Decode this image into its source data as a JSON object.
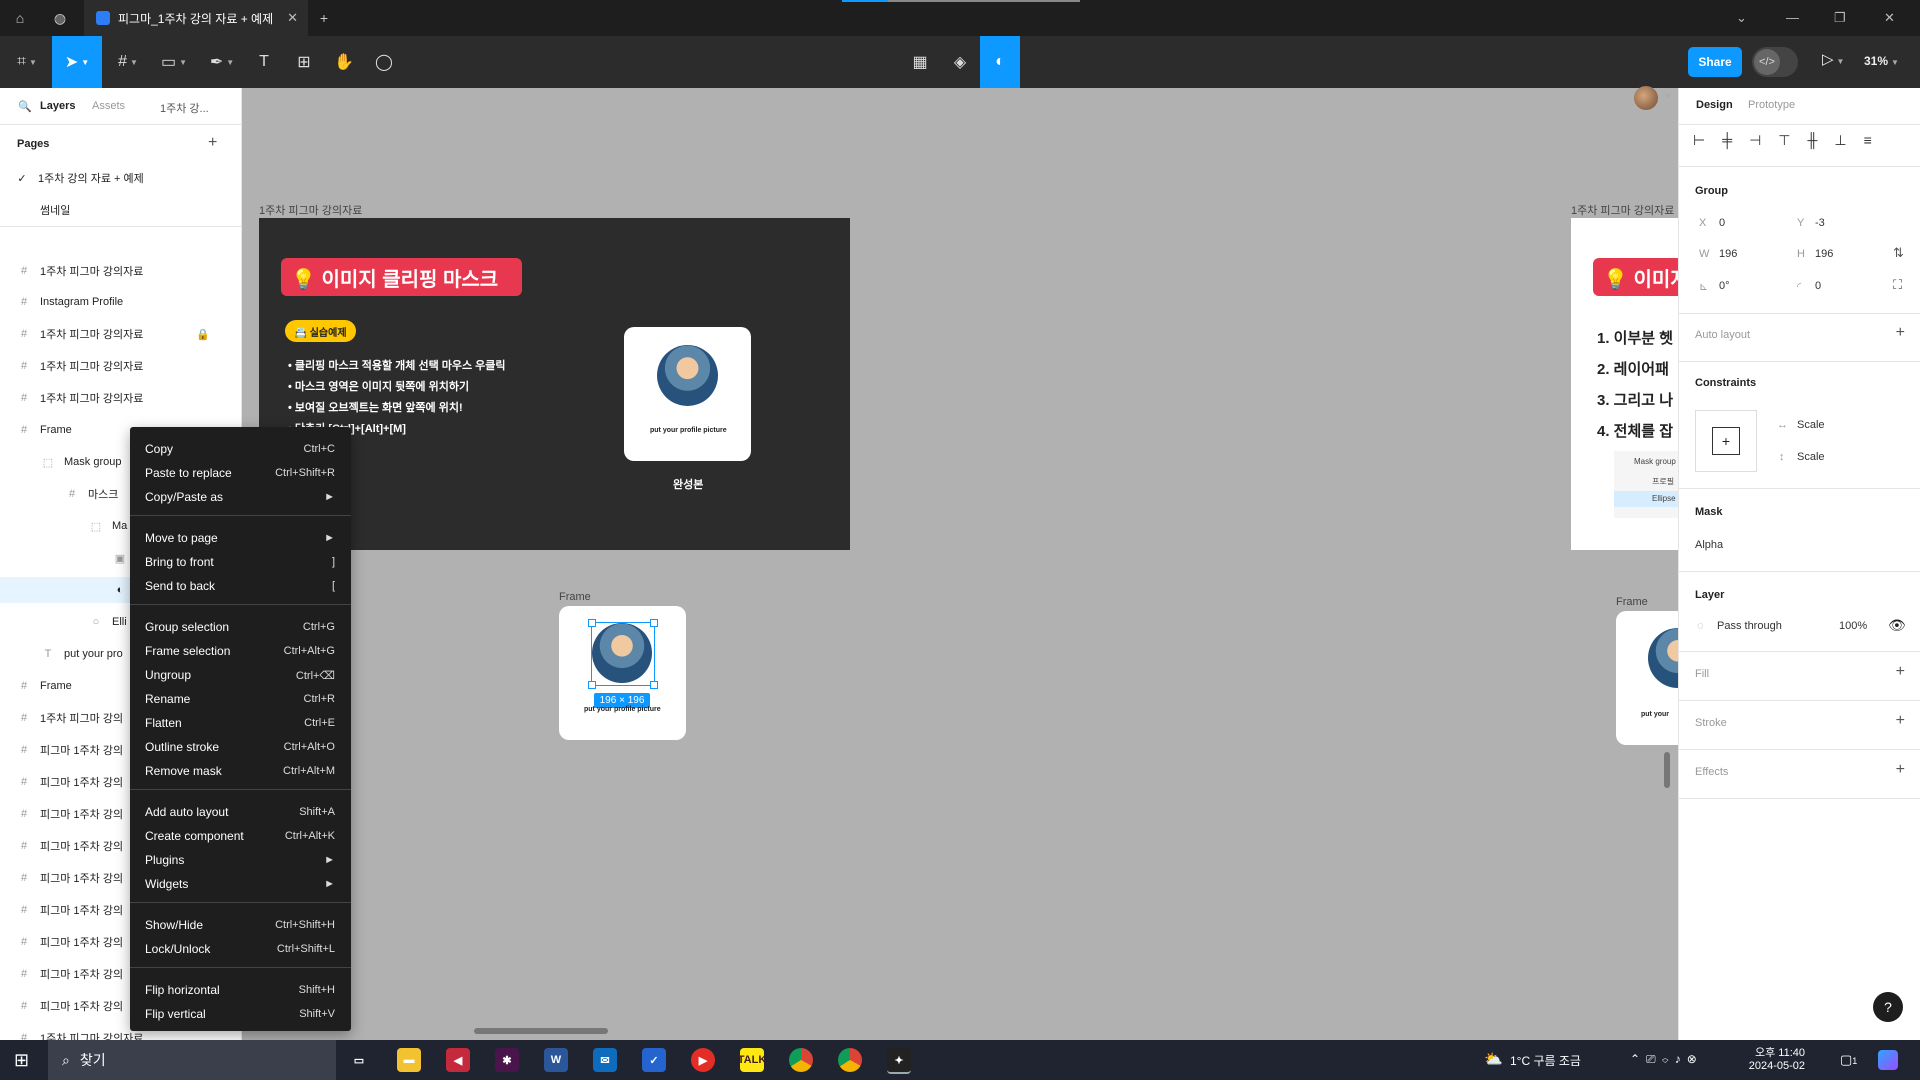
{
  "tab": {
    "title": "피그마_1주차 강의 자료 + 예제"
  },
  "toolbar": {
    "share": "Share",
    "zoom": "31%"
  },
  "left_panel": {
    "tabs": [
      "Layers",
      "Assets",
      "1주차 강..."
    ],
    "pages_title": "Pages",
    "pages": [
      "1주차 강의 자료 + 예제",
      "썸네일"
    ],
    "layers": [
      "1주차 피그마 강의자료",
      "Instagram Profile",
      "1주차 피그마 강의자료",
      "1주차 피그마 강의자료",
      "1주차 피그마 강의자료",
      "Frame",
      "Mask group",
      "마스크",
      "Ma",
      "",
      "",
      "Elli",
      "put your pro",
      "Frame",
      "1주차 피그마 강의",
      "피그마 1주차 강의",
      "피그마 1주차 강의",
      "피그마 1주차 강의",
      "피그마 1주차 강의",
      "피그마 1주차 강의",
      "피그마 1주차 강의",
      "피그마 1주차 강의",
      "피그마 1주차 강의",
      "피그마 1주차 강의",
      "1주차 피그마 강의자료"
    ]
  },
  "canvas": {
    "frame1_label": "1주차 피그마 강의자료",
    "frame1_title": "💡 이미지 클리핑 마스크",
    "frame1_chip": "📇 실습예제",
    "bullets": [
      "클리핑 마스크 적용할 개체 선택 마우스 우클릭",
      "마스크 영역은 이미지 뒷쪽에 위치하기",
      "보여질 오브젝트는 화면 앞쪽에 위치!",
      "단축키 [Ctrl]+[Alt]+[M]"
    ],
    "card_caption": "put your profile picture",
    "finished_label": "완성본",
    "frame2_label": "Frame",
    "size_badge": "196 × 196",
    "frame3_label": "1주차 피그마 강의자료",
    "frame3_title": "💡 이미지",
    "frame3_items": [
      "1. 이부분 헷",
      "2. 레이어패",
      "3. 그리고 나",
      "4. 전체를 잡"
    ],
    "frame3_sublayers": [
      "Mask group",
      "프로필",
      "Ellipse"
    ],
    "frame4_label": "Frame",
    "frame4_caption": "put your"
  },
  "context_menu": [
    {
      "label": "Copy",
      "shortcut": "Ctrl+C"
    },
    {
      "label": "Paste to replace",
      "shortcut": "Ctrl+Shift+R"
    },
    {
      "label": "Copy/Paste as",
      "shortcut": "►"
    },
    {
      "label": "Move to page",
      "shortcut": "►"
    },
    {
      "label": "Bring to front",
      "shortcut": "]"
    },
    {
      "label": "Send to back",
      "shortcut": "["
    },
    {
      "label": "Group selection",
      "shortcut": "Ctrl+G"
    },
    {
      "label": "Frame selection",
      "shortcut": "Ctrl+Alt+G"
    },
    {
      "label": "Ungroup",
      "shortcut": "Ctrl+⌫"
    },
    {
      "label": "Rename",
      "shortcut": "Ctrl+R"
    },
    {
      "label": "Flatten",
      "shortcut": "Ctrl+E"
    },
    {
      "label": "Outline stroke",
      "shortcut": "Ctrl+Alt+O"
    },
    {
      "label": "Remove mask",
      "shortcut": "Ctrl+Alt+M"
    },
    {
      "label": "Add auto layout",
      "shortcut": "Shift+A"
    },
    {
      "label": "Create component",
      "shortcut": "Ctrl+Alt+K"
    },
    {
      "label": "Plugins",
      "shortcut": "►"
    },
    {
      "label": "Widgets",
      "shortcut": "►"
    },
    {
      "label": "Show/Hide",
      "shortcut": "Ctrl+Shift+H"
    },
    {
      "label": "Lock/Unlock",
      "shortcut": "Ctrl+Shift+L"
    },
    {
      "label": "Flip horizontal",
      "shortcut": "Shift+H"
    },
    {
      "label": "Flip vertical",
      "shortcut": "Shift+V"
    }
  ],
  "right_panel": {
    "tabs": [
      "Design",
      "Prototype"
    ],
    "group": {
      "title": "Group",
      "x_label": "X",
      "x": "0",
      "y_label": "Y",
      "y": "-3",
      "w_label": "W",
      "w": "196",
      "h_label": "H",
      "h": "196",
      "rotation": "0°",
      "radius": "0"
    },
    "auto_layout": "Auto layout",
    "constraints": {
      "title": "Constraints",
      "horizontal": "Scale",
      "vertical": "Scale"
    },
    "mask": {
      "title": "Mask",
      "type": "Alpha"
    },
    "layer": {
      "title": "Layer",
      "blend": "Pass through",
      "opacity": "100%"
    },
    "fill": "Fill",
    "stroke": "Stroke",
    "effects": "Effects",
    "help": "?"
  },
  "taskbar": {
    "search": "찾기",
    "weather": "1°C  구름 조금",
    "time": "오후 11:40",
    "date": "2024-05-02",
    "notif": "1"
  }
}
